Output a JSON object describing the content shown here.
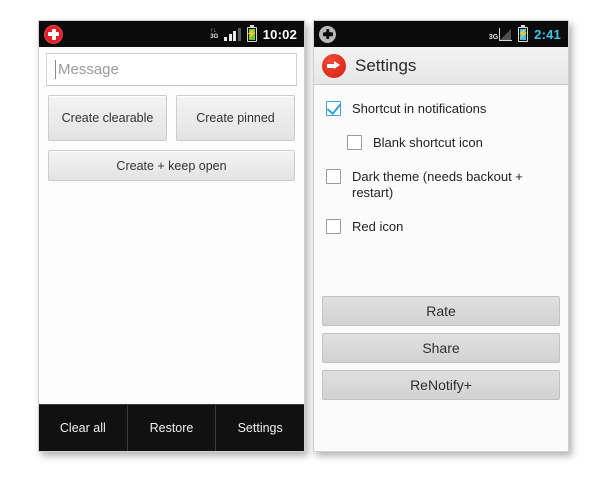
{
  "left_phone": {
    "status_bar": {
      "app_icon": "plus-circle-red-icon",
      "network_label": "3G",
      "network_arrows": "↑↓",
      "signal_icon": "signal-bars-icon",
      "battery_icon": "battery-charging-icon",
      "time": "10:02"
    },
    "message_input": {
      "placeholder": "Message",
      "value": ""
    },
    "buttons": {
      "create_clearable": "Create clearable",
      "create_pinned": "Create pinned",
      "create_keep_open": "Create + keep open"
    },
    "bottom_bar": {
      "clear_all": "Clear all",
      "restore": "Restore",
      "settings": "Settings"
    }
  },
  "right_phone": {
    "status_bar": {
      "app_icon": "plus-circle-grey-icon",
      "network_label": "3G",
      "signal_icon": "signal-triangle-icon",
      "battery_icon": "battery-charging-icon",
      "time": "2:41"
    },
    "title_bar": {
      "icon": "arrow-right-circle-red-icon",
      "title": "Settings"
    },
    "checkboxes": [
      {
        "label": "Shortcut in notifications",
        "checked": true,
        "indent": false
      },
      {
        "label": "Blank shortcut icon",
        "checked": false,
        "indent": true
      },
      {
        "label": "Dark theme (needs backout + restart)",
        "checked": false,
        "indent": false
      },
      {
        "label": "Red icon",
        "checked": false,
        "indent": false
      }
    ],
    "action_buttons": [
      {
        "label": "Rate"
      },
      {
        "label": "Share"
      },
      {
        "label": "ReNotify+"
      }
    ]
  },
  "colors": {
    "status_bar_bg": "#0b0b0b",
    "accent_red": "#e12128",
    "checkbox_blue": "#35a2da",
    "time_cyan": "#3fc4e8",
    "battery_green": "#6fc92b",
    "bottom_bar_bg": "#111111"
  }
}
